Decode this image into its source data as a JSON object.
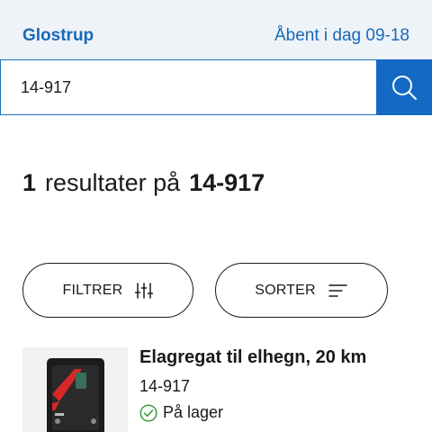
{
  "header": {
    "store_name": "Glostrup",
    "opening_hours": "Åbent i dag 09-18"
  },
  "search": {
    "value": "14-917",
    "button_icon": "search-icon"
  },
  "results": {
    "count": "1",
    "text": "resultater på",
    "query": "14-917"
  },
  "controls": {
    "filter_label": "FILTRER",
    "filter_icon": "sliders-icon",
    "sort_label": "SORTER",
    "sort_icon": "sort-lines-icon"
  },
  "product": {
    "title": "Elagregat til elhegn, 20 km",
    "sku": "14-917",
    "stock_status": "På lager",
    "stock_icon": "check-circle-icon",
    "stock_color": "#3a9a3a"
  },
  "colors": {
    "brand_blue": "#1469c4",
    "header_bg": "#eef3f8"
  }
}
